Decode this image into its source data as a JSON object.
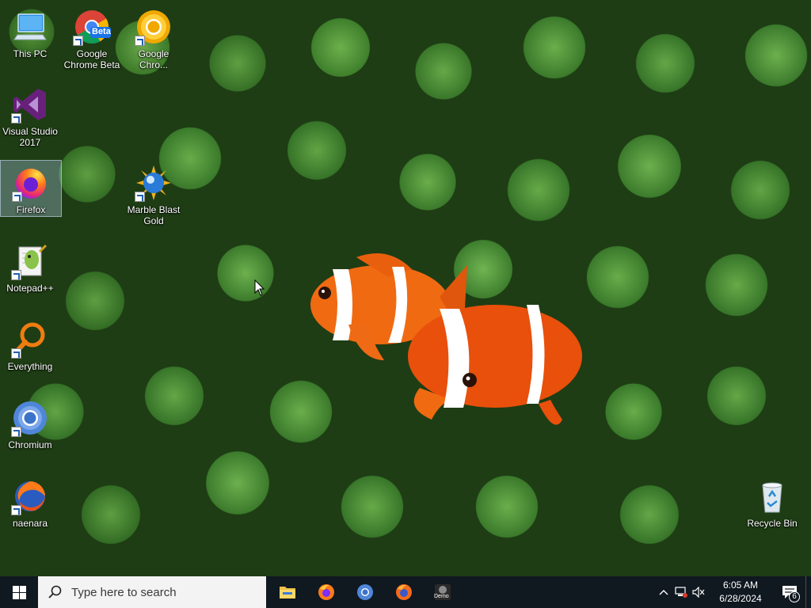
{
  "desktop": {
    "icons": [
      {
        "label": "This PC",
        "icon": "computer-icon"
      },
      {
        "label": "Google\nChrome Beta",
        "icon": "chrome-beta-icon",
        "badge": "Beta"
      },
      {
        "label": "Google\nChro...",
        "icon": "chrome-canary-icon"
      },
      {
        "label": "Visual Studio\n2017",
        "icon": "visual-studio-icon"
      },
      {
        "label": "Firefox",
        "icon": "firefox-icon"
      },
      {
        "label": "Marble Blast\nGold",
        "icon": "marble-blast-icon"
      },
      {
        "label": "Notepad++",
        "icon": "notepad-plus-plus-icon"
      },
      {
        "label": "Everything",
        "icon": "everything-search-icon"
      },
      {
        "label": "Chromium",
        "icon": "chromium-icon"
      },
      {
        "label": "naenara",
        "icon": "naenara-icon"
      },
      {
        "label": "Recycle Bin",
        "icon": "recycle-bin-icon"
      }
    ],
    "wallpaper": "clownfish-anemone"
  },
  "taskbar": {
    "search_placeholder": "Type here to search",
    "pinned": [
      {
        "name": "file-explorer-icon"
      },
      {
        "name": "firefox-icon"
      },
      {
        "name": "chromium-icon"
      },
      {
        "name": "firefox-icon"
      },
      {
        "name": "demo-app-icon",
        "label": "Demo"
      }
    ],
    "clock": {
      "time": "6:05 AM",
      "date": "6/28/2024"
    },
    "notifications_count": "6"
  },
  "colors": {
    "taskbar_bg": "#101820",
    "search_bg": "#f3f3f3",
    "selection": "#aac8e6"
  }
}
